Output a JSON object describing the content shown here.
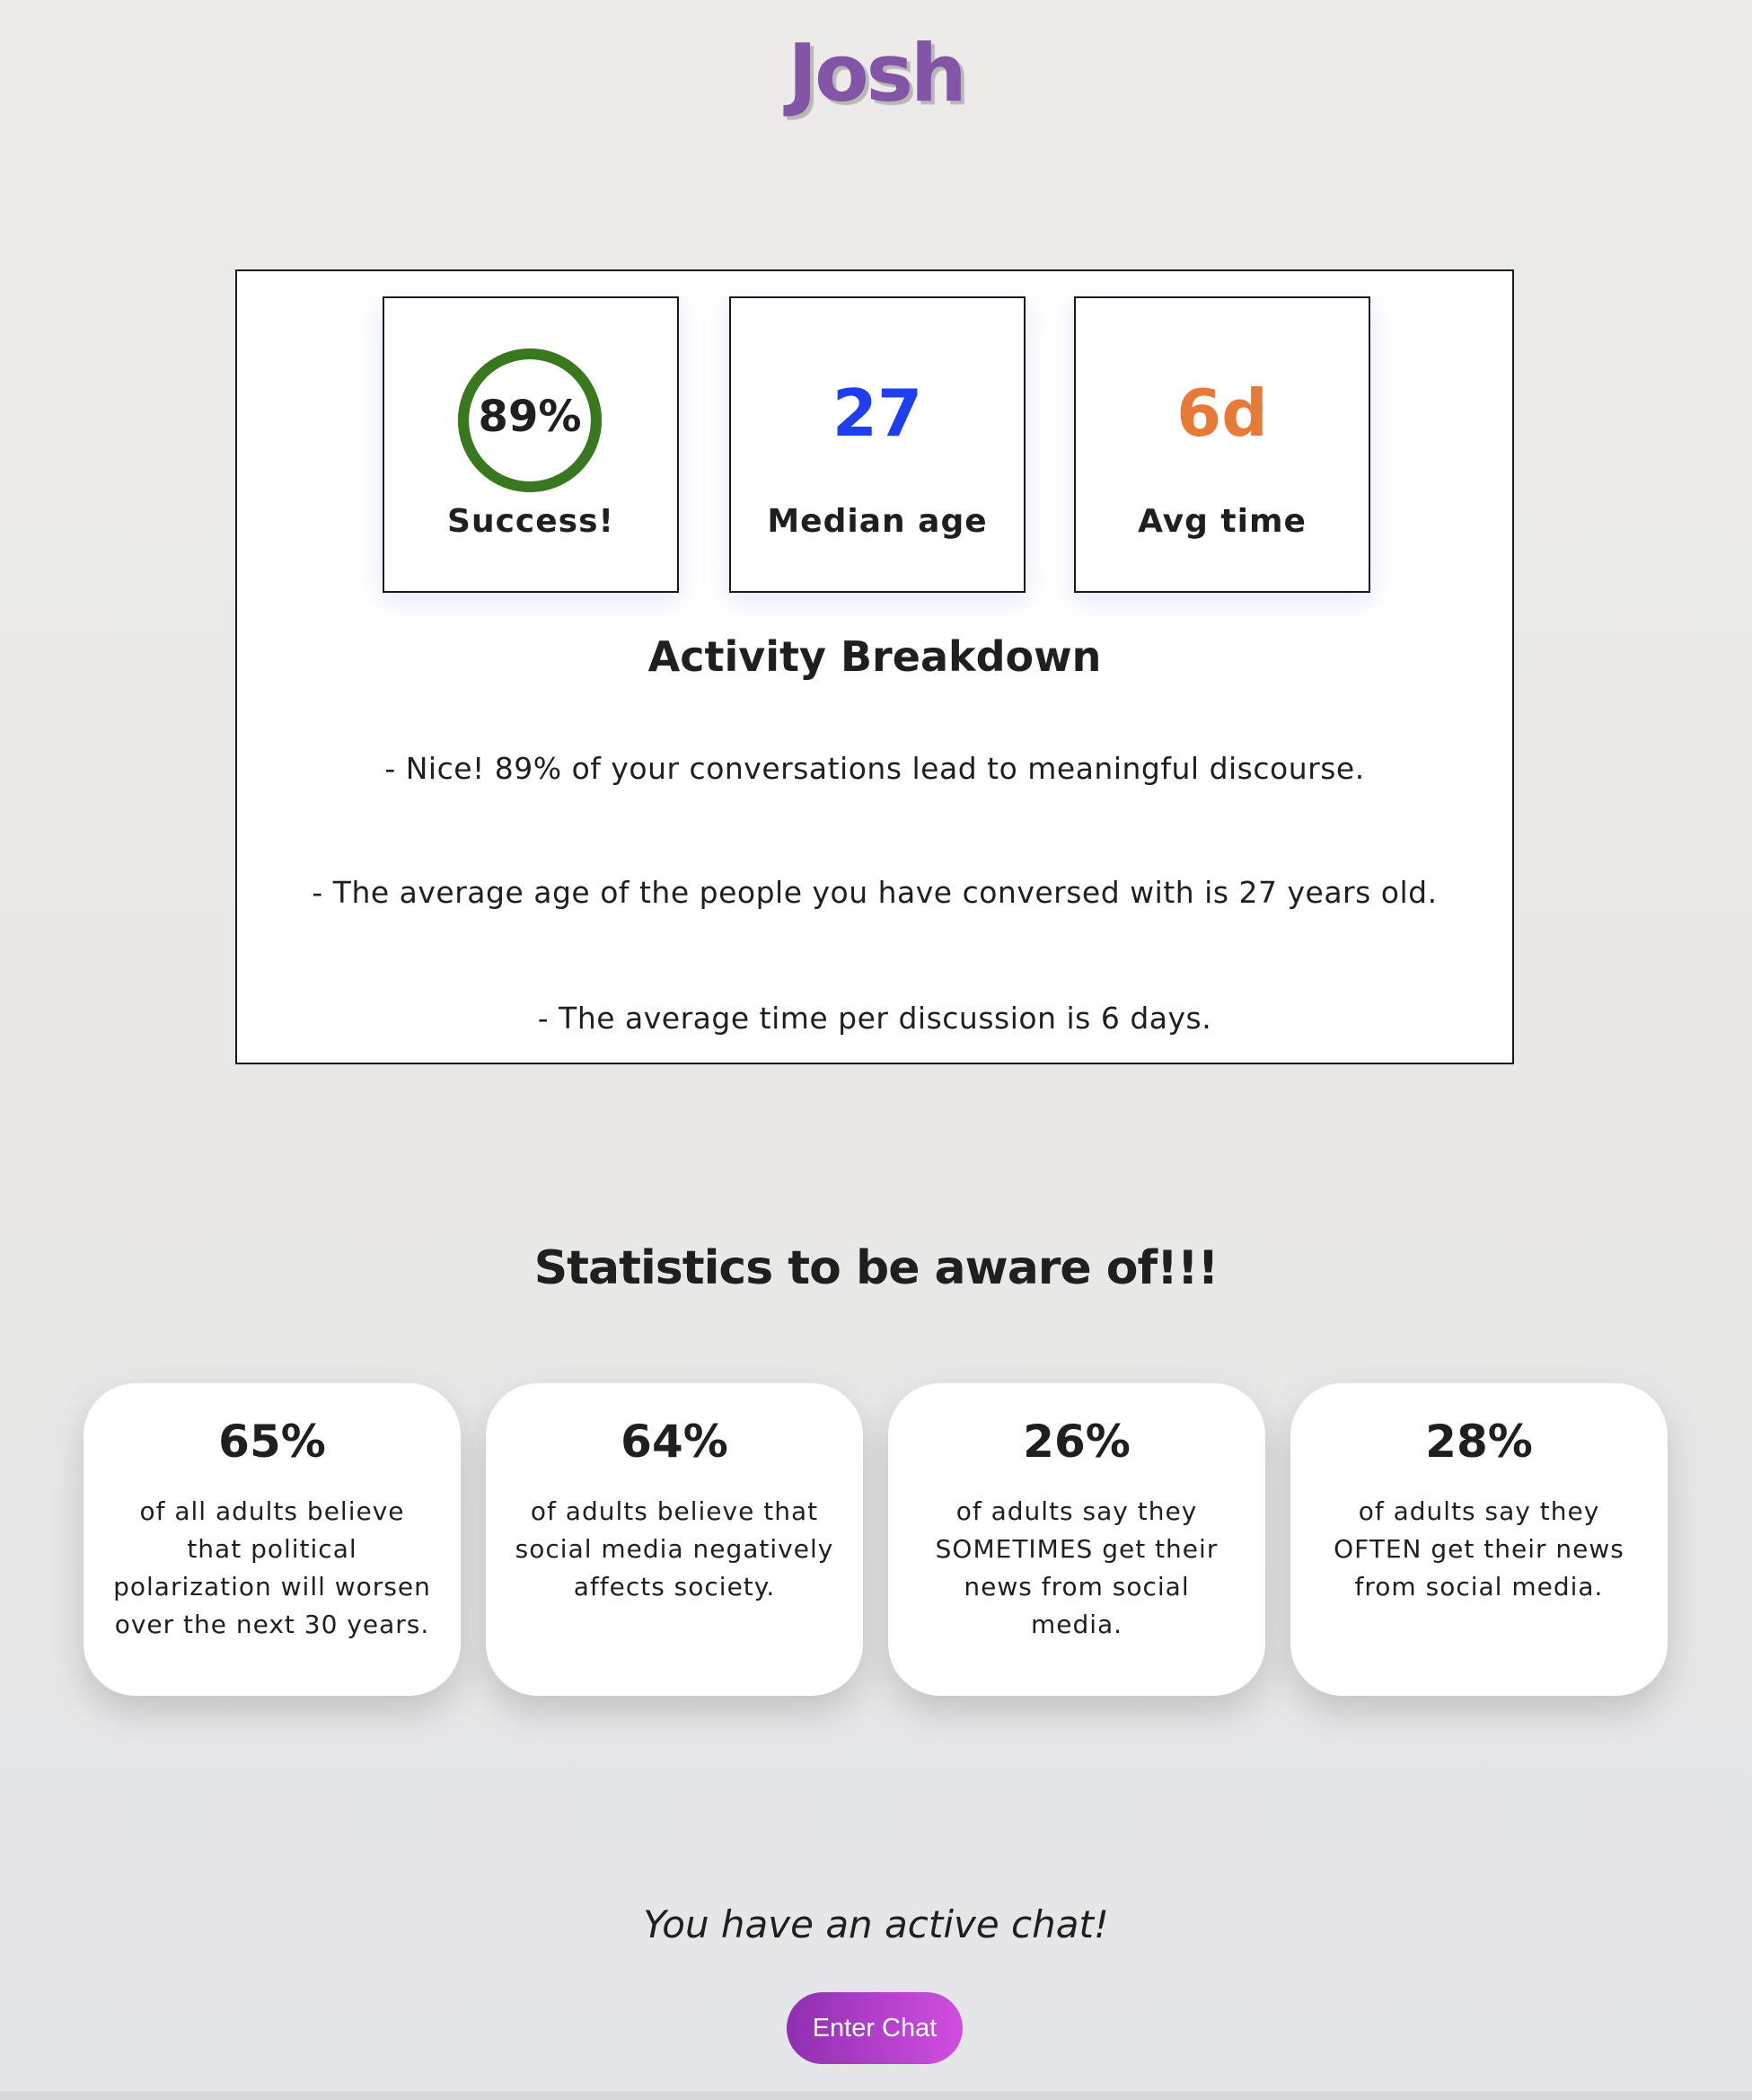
{
  "header": {
    "user_name": "Josh"
  },
  "activity": {
    "metrics": [
      {
        "value": "89%",
        "label": "Success!",
        "progress": 0.89
      },
      {
        "value": "27",
        "label": "Median age"
      },
      {
        "value": "6d",
        "label": "Avg time"
      }
    ],
    "breakdown_title": "Activity Breakdown",
    "lines": [
      "- Nice! 89% of your conversations lead to meaningful discourse.",
      "- The average age of the people you have conversed with is 27 years old.",
      "- The average time per discussion is 6 days."
    ]
  },
  "statistics": {
    "title": "Statistics to be aware of!!!",
    "cards": [
      {
        "value": "65%",
        "text": "of all adults believe that political polarization will worsen over the next 30 years."
      },
      {
        "value": "64%",
        "text": "of adults believe that social media negatively affects society."
      },
      {
        "value": "26%",
        "text": "of adults say they SOMETIMES get their news from social media."
      },
      {
        "value": "28%",
        "text": "of adults say they OFTEN get their news from social media."
      }
    ]
  },
  "chat": {
    "note": "You have an active chat!",
    "button_label": "Enter Chat"
  },
  "colors": {
    "name": "#8455a6",
    "success_ring": "#38791f",
    "median_age": "#1d3ff0",
    "avg_time": "#e87a38",
    "button_start": "#8f2fb1",
    "button_end": "#d14ee0"
  },
  "icons": {
    "success_indicator": "progress-ring-icon"
  }
}
